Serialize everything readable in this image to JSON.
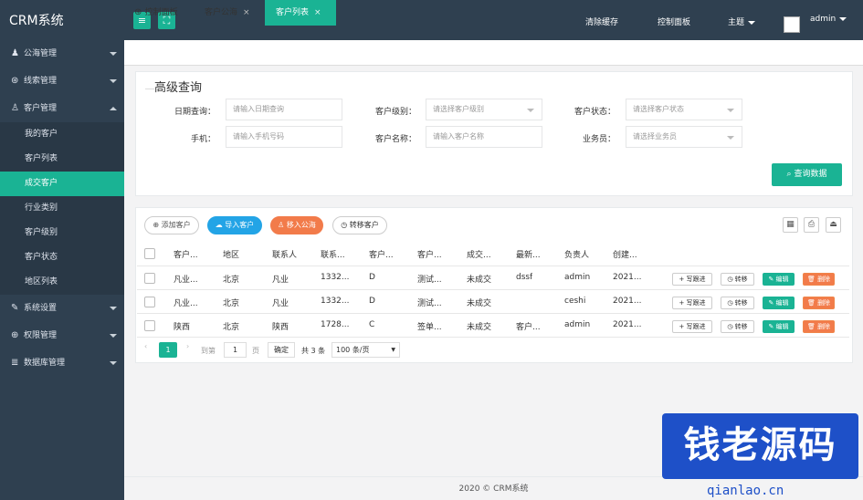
{
  "app": {
    "brand": "CRM系统"
  },
  "topnav": {
    "clear_cache": "清除缓存",
    "dashboard": "控制面板",
    "theme": "主题",
    "user": "admin"
  },
  "sidebar": {
    "menus": [
      {
        "label": "公海管理",
        "icon": "user-group-icon"
      },
      {
        "label": "线索管理",
        "icon": "compass-icon"
      },
      {
        "label": "客户管理",
        "icon": "user-icon"
      },
      {
        "label": "系统设置",
        "icon": "wrench-icon"
      },
      {
        "label": "权限管理",
        "icon": "globe-icon"
      },
      {
        "label": "数据库管理",
        "icon": "database-icon"
      }
    ],
    "submenu": [
      "我的客户",
      "客户列表",
      "成交客户",
      "行业类别",
      "客户级别",
      "客户状态",
      "地区列表"
    ]
  },
  "tabs": [
    {
      "label": "控制面板"
    },
    {
      "label": "客户公海"
    },
    {
      "label": "客户列表"
    }
  ],
  "search": {
    "title": "高级查询",
    "date_label": "日期查询：",
    "date_placeholder": "请输入日期查询",
    "level_label": "客户级别：",
    "level_placeholder": "请选择客户级别",
    "status_label": "客户状态：",
    "status_placeholder": "请选择客户状态",
    "phone_label": "手机：",
    "phone_placeholder": "请输入手机号码",
    "name_label": "客户名称：",
    "name_placeholder": "请输入客户名称",
    "sales_label": "业务员：",
    "sales_placeholder": "请选择业务员",
    "search_button": "查询数据"
  },
  "toolbar": {
    "add": "添加客户",
    "import": "导入客户",
    "to_pool": "移入公海",
    "transfer": "转移客户"
  },
  "table": {
    "headers": [
      "客户...",
      "地区",
      "联系人",
      "联系...",
      "客户...",
      "客户...",
      "成交...",
      "最新...",
      "负责人",
      "创建..."
    ],
    "rows": [
      [
        "凡业...",
        "北京",
        "凡业",
        "1332...",
        "D",
        "测试...",
        "未成交",
        "dssf",
        "admin",
        "2021..."
      ],
      [
        "凡业...",
        "北京",
        "凡业",
        "1332...",
        "D",
        "测试...",
        "未成交",
        "",
        "ceshi",
        "2021..."
      ],
      [
        "陕西",
        "北京",
        "陕西",
        "1728...",
        "C",
        "签单...",
        "未成交",
        "客户...",
        "admin",
        "2021..."
      ]
    ],
    "row_actions": {
      "follow": "写跟进",
      "transfer": "转移",
      "edit": "编辑",
      "delete": "删除"
    }
  },
  "pager": {
    "current": "1",
    "goto": "到第",
    "page_input": "1",
    "page_unit": "页",
    "confirm": "确定",
    "total": "共 3 条",
    "per_page": "100 条/页"
  },
  "footer": {
    "text": "2020 ©   CRM系统"
  },
  "watermark": {
    "text": "钱老源码",
    "url": "qianlao.cn"
  }
}
